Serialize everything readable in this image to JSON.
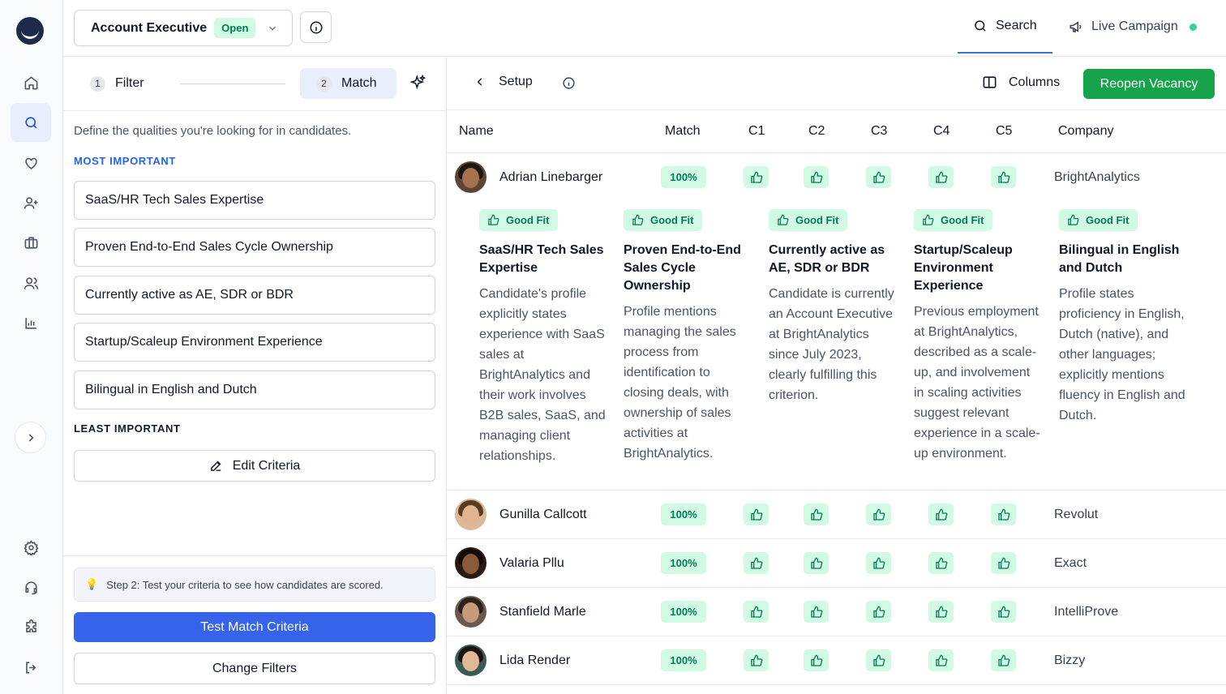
{
  "topbar": {
    "job_title": "Account Executive",
    "job_status": "Open",
    "tabs": [
      {
        "label": "Search",
        "icon": "search-icon",
        "active": true
      },
      {
        "label": "Live Campaign",
        "icon": "megaphone-icon",
        "status_color": "#34d399"
      }
    ]
  },
  "rail": {
    "items": [
      {
        "name": "home-icon"
      },
      {
        "name": "search-icon",
        "active": true
      },
      {
        "name": "heart-icon"
      },
      {
        "name": "add-user-icon"
      },
      {
        "name": "briefcase-icon"
      },
      {
        "name": "users-icon"
      },
      {
        "name": "bar-chart-icon"
      }
    ],
    "bottom": [
      {
        "name": "gear-icon"
      },
      {
        "name": "headset-icon"
      },
      {
        "name": "puzzle-icon"
      },
      {
        "name": "logout-icon"
      }
    ]
  },
  "left_panel": {
    "steps": [
      {
        "num": "1",
        "label": "Filter"
      },
      {
        "num": "2",
        "label": "Match",
        "active": true
      }
    ],
    "intro": "Define the qualities you're looking for in candidates.",
    "most_important_label": "MOST IMPORTANT",
    "least_important_label": "LEAST IMPORTANT",
    "criteria": [
      "SaaS/HR Tech Sales Expertise",
      "Proven End-to-End Sales Cycle Ownership",
      "Currently active as AE, SDR or BDR",
      "Startup/Scaleup Environment Experience",
      "Bilingual in English and Dutch"
    ],
    "edit_label": "Edit Criteria",
    "hint": "Step 2: Test your criteria to see how candidates are scored.",
    "test_label": "Test Match Criteria",
    "change_filters_label": "Change Filters"
  },
  "right_panel": {
    "setup_label": "Setup",
    "columns_label": "Columns",
    "reopen_label": "Reopen Vacancy",
    "columns": [
      "Name",
      "Match",
      "C1",
      "C2",
      "C3",
      "C4",
      "C5",
      "Company"
    ],
    "good_fit_label": "Good Fit",
    "candidates": [
      {
        "name": "Adrian Linebarger",
        "match": "100%",
        "company": "BrightAnalytics"
      },
      {
        "name": "Gunilla Callcott",
        "match": "100%",
        "company": "Revolut"
      },
      {
        "name": "Valaria Pllu",
        "match": "100%",
        "company": "Exact"
      },
      {
        "name": "Stanfield Marle",
        "match": "100%",
        "company": "IntelliProve"
      },
      {
        "name": "Lida Render",
        "match": "100%",
        "company": "Bizzy"
      }
    ],
    "details": [
      {
        "title": "SaaS/HR Tech Sales Expertise",
        "text": "Candidate's profile explicitly states experience with SaaS sales at BrightAnalytics and their work involves B2B sales, SaaS, and managing client relationships."
      },
      {
        "title": "Proven End-to-End Sales Cycle Ownership",
        "text": "Profile mentions managing the sales process from identification to closing deals, with ownership of sales activities at BrightAnalytics."
      },
      {
        "title": "Currently active as AE, SDR or BDR",
        "text": "Candidate is currently an Account Executive at BrightAnalytics since July 2023, clearly fulfilling this criterion."
      },
      {
        "title": "Startup/Scaleup Environment Experience",
        "text": "Previous employment at BrightAnalytics, described as a scale-up, and involvement in scaling activities suggest relevant experience in a scale-up environment."
      },
      {
        "title": "Bilingual in English and Dutch",
        "text": "Profile states proficiency in English, Dutch (native), and other languages; explicitly mentions fluency in English and Dutch."
      }
    ]
  },
  "colors": {
    "accent": "#3563e9",
    "success": "#16a34a",
    "badge_bg": "#d1fae5",
    "badge_text": "#047857"
  }
}
